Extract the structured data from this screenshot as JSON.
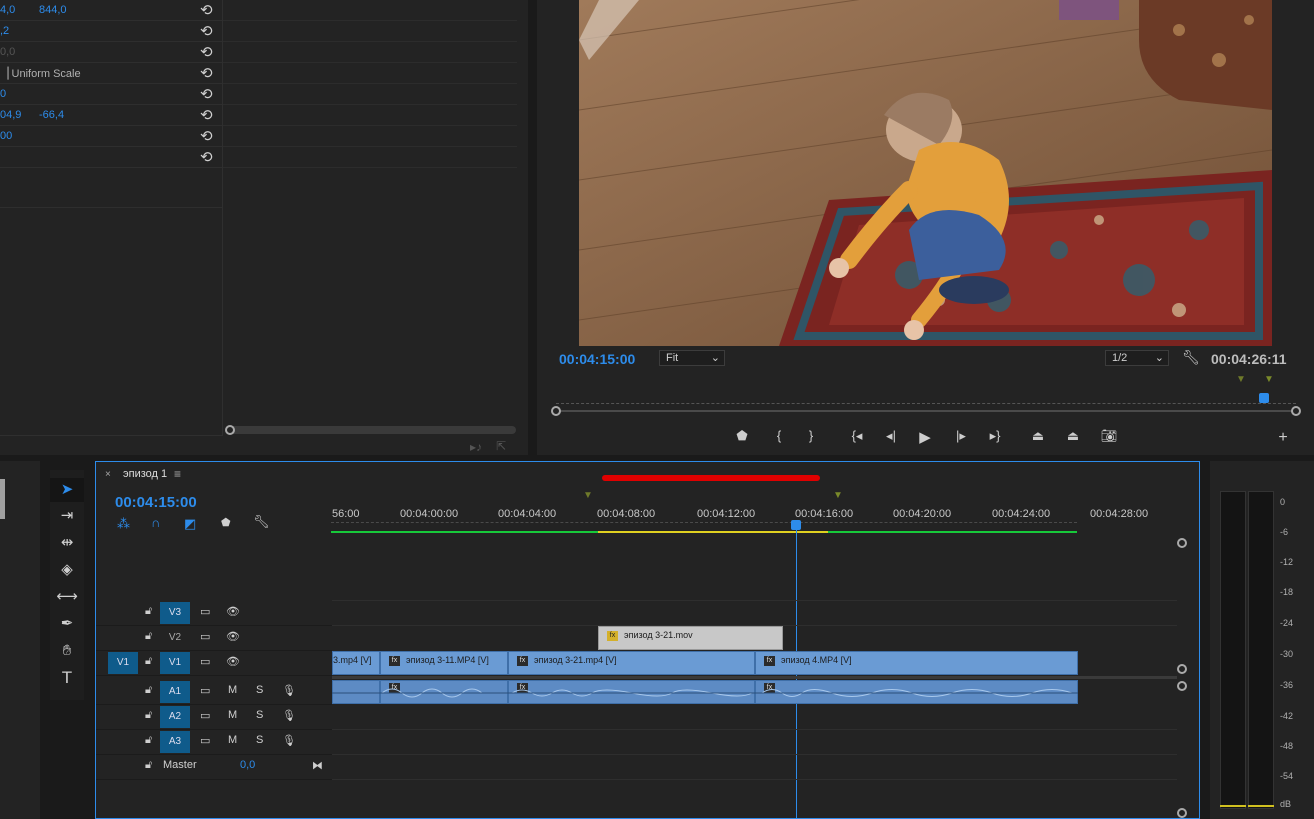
{
  "effects": {
    "rows": [
      {
        "v1": "4,0",
        "v2": "844,0"
      },
      {
        "v1": ",2",
        "v2": ""
      },
      {
        "v1": "0,0",
        "v2": "",
        "dim": true
      },
      {
        "v1": "",
        "v2": "",
        "checkbox_label": "Uniform Scale"
      },
      {
        "v1": "0",
        "v2": ""
      },
      {
        "v1": "04,9",
        "v2": "-66,4"
      },
      {
        "v1": "00",
        "v2": ""
      },
      {
        "v1": "",
        "v2": ""
      }
    ]
  },
  "program": {
    "timecode_current": "00:04:15:00",
    "fit_select": "Fit",
    "resolution_select": "1/2",
    "timecode_duration": "00:04:26:11",
    "controls": [
      "marker-icon",
      "mark-in-icon",
      "mark-out-icon",
      "go-to-in-icon",
      "step-back-icon",
      "play-icon",
      "step-forward-icon",
      "go-to-out-icon",
      "lift-icon",
      "extract-icon",
      "export-frame-icon",
      "add-button-icon"
    ]
  },
  "timeline": {
    "tab_title": "эпизод 1",
    "timecode": "00:04:15:00",
    "ruler": [
      "56:00",
      "00:04:00:00",
      "00:04:04:00",
      "00:04:08:00",
      "00:04:12:00",
      "00:04:16:00",
      "00:04:20:00",
      "00:04:24:00",
      "00:04:28:00"
    ],
    "tracks": {
      "v3": "V3",
      "v2": "V2",
      "v1": "V1",
      "v1_source": "V1",
      "a1": "A1",
      "a2": "A2",
      "a3": "A3",
      "mute": "M",
      "solo": "S",
      "master": "Master",
      "master_value": "0,0"
    },
    "clips": {
      "v2_clip": "эпизод 3-21.mov",
      "v1_clip_a": "3.mp4 [V]",
      "v1_clip_b": "эпизод 3-11.MP4 [V]",
      "v1_clip_c": "эпизод 3-21.mp4 [V]",
      "v1_clip_d": "эпизод 4.MP4 [V]",
      "fx_badge": "fx"
    }
  },
  "meter": {
    "scale": [
      "0",
      "-6",
      "-12",
      "-18",
      "-24",
      "-30",
      "-36",
      "-42",
      "-48",
      "-54",
      "dB"
    ]
  },
  "colors": {
    "accent": "#2d8ceb",
    "track_blue": "#0f5b8b",
    "clip_video": "#6a9bd4",
    "clip_adjust": "#c8c8c8",
    "annotation_red": "#e00000"
  }
}
